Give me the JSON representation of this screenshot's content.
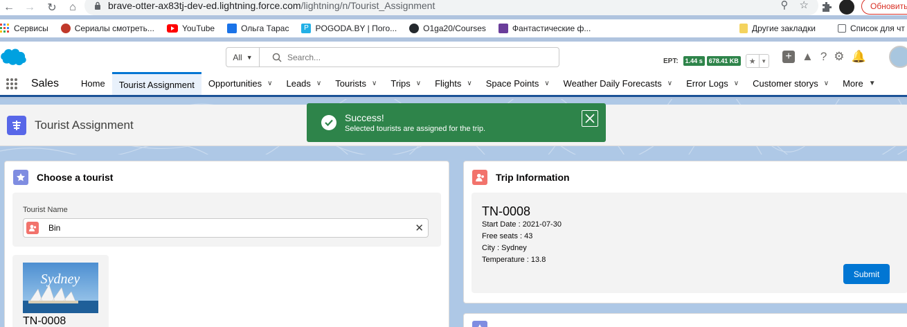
{
  "browser": {
    "url_host": "brave-otter-ax83tj-dev-ed.lightning.force.com",
    "url_path": "/lightning/n/Tourist_Assignment",
    "update_label": "Обновить"
  },
  "bookmarks": {
    "items": [
      "Сервисы",
      "Сериалы смотреть...",
      "YouTube",
      "Ольга Тарас",
      "POGODA.BY | Пого...",
      "O1ga20/Courses",
      "Фантастические ф..."
    ],
    "other": "Другие закладки",
    "reading_list": "Список для чт"
  },
  "header": {
    "search_scope": "All",
    "search_placeholder": "Search...",
    "ept_label": "EPT:",
    "ept_time": "1.44 s",
    "ept_size": "678.41 KB"
  },
  "nav": {
    "app_name": "Sales",
    "items": [
      "Home",
      "Tourist Assignment",
      "Opportunities",
      "Leads",
      "Tourists",
      "Trips",
      "Flights",
      "Space Points",
      "Weather Daily Forecasts",
      "Error Logs",
      "Customer storys",
      "More"
    ]
  },
  "page": {
    "title": "Tourist Assignment"
  },
  "toast": {
    "title": "Success!",
    "message": "Selected tourists are assigned for the trip."
  },
  "choose": {
    "title": "Choose a tourist",
    "field_label": "Tourist Name",
    "field_value": "Bin",
    "tile_name": "TN-0008",
    "tile_image_text": "Sydney"
  },
  "trip": {
    "title": "Trip Information",
    "name": "TN-0008",
    "start_date": "Start Date : 2021-07-30",
    "free_seats": "Free seats : 43",
    "city": "City : Sydney",
    "temperature": "Temperature : 13.8",
    "submit_label": "Submit"
  },
  "colors": {
    "brand_blue": "#0176d3",
    "nav_underline": "#1b5297",
    "success_green": "#2e844a",
    "tab_icon_purple": "#5867e8",
    "contact_icon_red": "#f2736c"
  }
}
